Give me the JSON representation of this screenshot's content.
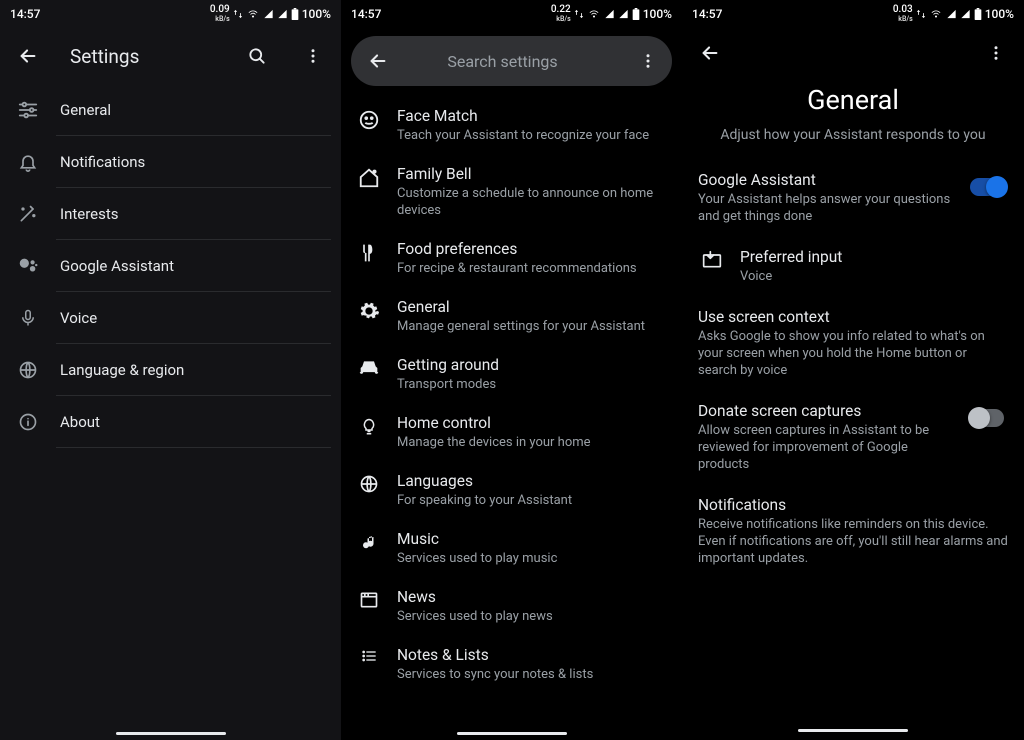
{
  "status": {
    "time": "14:57",
    "battery": "100%"
  },
  "speeds": {
    "p1": "0.09",
    "p2": "0.22",
    "p3": "0.03"
  },
  "screen1": {
    "title": "Settings",
    "items": [
      {
        "label": "General"
      },
      {
        "label": "Notifications"
      },
      {
        "label": "Interests"
      },
      {
        "label": "Google Assistant"
      },
      {
        "label": "Voice"
      },
      {
        "label": "Language & region"
      },
      {
        "label": "About"
      }
    ]
  },
  "screen2": {
    "search_placeholder": "Search settings",
    "items": [
      {
        "title": "Face Match",
        "sub": "Teach your Assistant to recognize your face"
      },
      {
        "title": "Family Bell",
        "sub": "Customize a schedule to announce on home devices"
      },
      {
        "title": "Food preferences",
        "sub": "For recipe & restaurant recommendations"
      },
      {
        "title": "General",
        "sub": "Manage general settings for your Assistant"
      },
      {
        "title": "Getting around",
        "sub": "Transport modes"
      },
      {
        "title": "Home control",
        "sub": "Manage the devices in your home"
      },
      {
        "title": "Languages",
        "sub": "For speaking to your Assistant"
      },
      {
        "title": "Music",
        "sub": "Services used to play music"
      },
      {
        "title": "News",
        "sub": "Services used to play news"
      },
      {
        "title": "Notes & Lists",
        "sub": "Services to sync your notes & lists"
      }
    ]
  },
  "screen3": {
    "title": "General",
    "subtitle": "Adjust how your Assistant responds to you",
    "items": [
      {
        "title": "Google Assistant",
        "sub": "Your Assistant helps answer your questions and get things done"
      },
      {
        "title": "Preferred input",
        "sub": "Voice"
      },
      {
        "title": "Use screen context",
        "sub": "Asks Google to show you info related to what's on your screen when you hold the Home button or search by voice"
      },
      {
        "title": "Donate screen captures",
        "sub": "Allow screen captures in Assistant to be reviewed for improvement of Google products"
      },
      {
        "title": "Notifications",
        "sub": "Receive notifications like reminders on this device. Even if notifications are off, you'll still hear alarms and important updates."
      }
    ]
  }
}
